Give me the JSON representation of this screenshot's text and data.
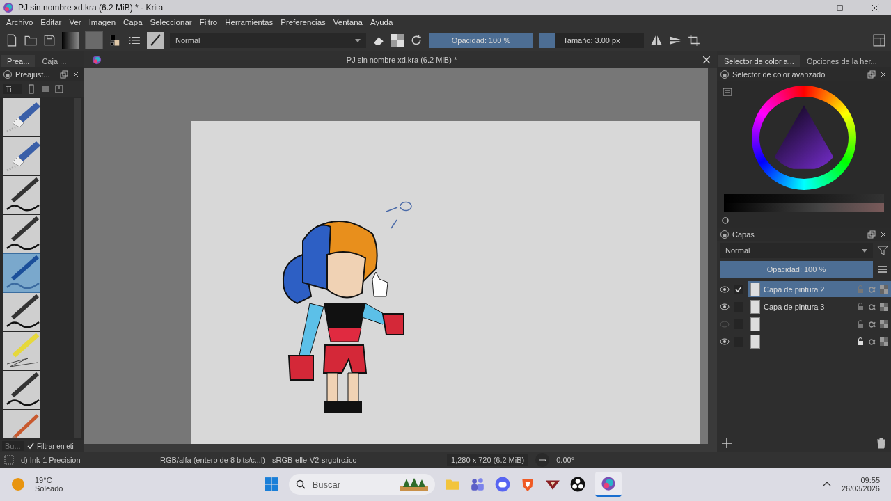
{
  "window": {
    "title": "PJ sin nombre xd.kra (6.2 MiB) * - Krita"
  },
  "menu": [
    "Archivo",
    "Editar",
    "Ver",
    "Imagen",
    "Capa",
    "Seleccionar",
    "Filtro",
    "Herramientas",
    "Preferencias",
    "Ventana",
    "Ayuda"
  ],
  "toolbar": {
    "blend_mode": "Normal",
    "opacity": {
      "label": "Opacidad: 100 %",
      "level": 1
    },
    "size": {
      "label": "Tamaño: 3.00 px",
      "level": 0.02
    }
  },
  "left_docker": {
    "tabs": [
      {
        "label": "Prea...",
        "selected": true
      },
      {
        "label": "Caja ...",
        "selected": false
      }
    ],
    "title": "Preajust...",
    "tag_filter": "Ti",
    "brushes": [
      {
        "kind": "eraser",
        "selected": false
      },
      {
        "kind": "eraser",
        "selected": false
      },
      {
        "kind": "pen",
        "selected": false
      },
      {
        "kind": "pen",
        "selected": false
      },
      {
        "kind": "pen",
        "selected": true
      },
      {
        "kind": "pen",
        "selected": false
      },
      {
        "kind": "marker",
        "selected": false
      },
      {
        "kind": "pen",
        "selected": false
      },
      {
        "kind": "brush",
        "selected": false
      }
    ],
    "search": {
      "placeholder": "Bu..."
    },
    "filter": {
      "label": "Filtrar en eti",
      "checked": true
    }
  },
  "document": {
    "tab": "PJ sin nombre xd.kra (6.2 MiB) *"
  },
  "right_docker": {
    "tabs": [
      {
        "label": "Selector de color a...",
        "selected": true
      },
      {
        "label": "Opciones de la her...",
        "selected": false
      }
    ],
    "color_title": "Selector de color avanzado",
    "layers": {
      "title": "Capas",
      "blend_mode": "Normal",
      "opacity": {
        "label": "Opacidad:  100 %",
        "level": 1
      },
      "items": [
        {
          "name": "Capa de pintura 2",
          "visible": true,
          "selected": true,
          "locked": false
        },
        {
          "name": "Capa de pintura 3",
          "visible": true,
          "selected": false,
          "locked": false
        },
        {
          "visible": false,
          "selected": false,
          "locked": false
        },
        {
          "visible": true,
          "selected": false,
          "locked": true
        }
      ]
    }
  },
  "status_bar": {
    "brush": "d) Ink-1 Precision",
    "color_space": "RGB/alfa (entero de 8 bits/c...l)",
    "profile": "sRGB-elle-V2-srgbtrc.icc",
    "dimensions": "1,280 x 720 (6.2 MiB)",
    "rotation": "0.00°"
  },
  "taskbar": {
    "temperature": "19°C",
    "weather": "Soleado",
    "search_placeholder": "Buscar",
    "time": "09:55",
    "date": "26/03/2026"
  }
}
